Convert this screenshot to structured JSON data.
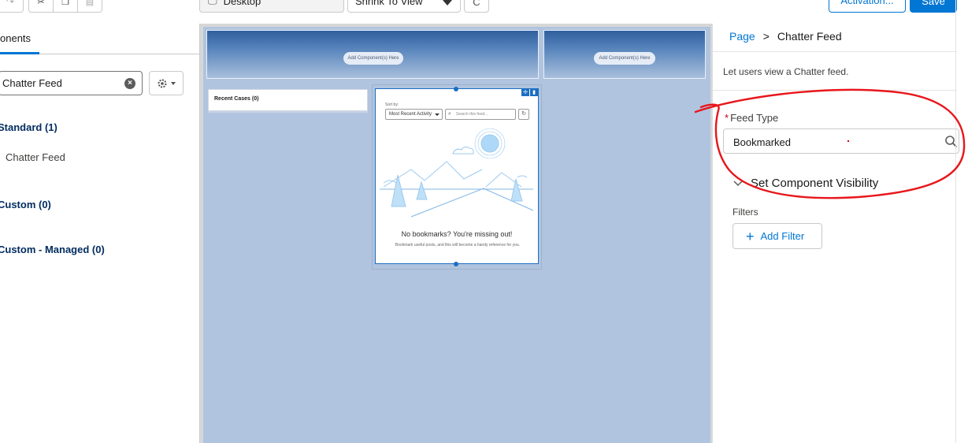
{
  "toolbar": {
    "device_label": "Desktop",
    "zoom_label": "Shrink To View",
    "activation_label": "Activation...",
    "save_label": "Save"
  },
  "left_panel": {
    "tab_label": "onents",
    "search_value": "Chatter Feed",
    "sections": {
      "standard": "Standard (1)",
      "standard_item": "Chatter Feed",
      "custom": "Custom (0)",
      "custom_managed": "Custom - Managed (0)"
    }
  },
  "canvas": {
    "add_component_label": "Add Component(s) Here",
    "add_component_label_2": "Add Component(s) Here",
    "recent_cases_title": "Recent Cases (0)",
    "feed": {
      "sort_by_label": "Sort by:",
      "sort_value": "Most Recent Activity",
      "search_placeholder": "Search this feed...",
      "empty_title": "No bookmarks? You're missing out!",
      "empty_subtitle": "Bookmark useful posts, and this will become a handy reference for you."
    }
  },
  "right_panel": {
    "breadcrumb_page": "Page",
    "breadcrumb_sep": ">",
    "breadcrumb_current": "Chatter Feed",
    "description": "Let users view a Chatter feed.",
    "feed_type_required": "*",
    "feed_type_label": "Feed Type",
    "feed_type_value": "Bookmarked",
    "visibility_label": "Set Component Visibility",
    "filters_label": "Filters",
    "add_filter_label": "Add Filter"
  },
  "colors": {
    "brand_blue": "#0176d3",
    "canvas_blue": "#b0c4df",
    "annotation_red": "#e8161b"
  }
}
